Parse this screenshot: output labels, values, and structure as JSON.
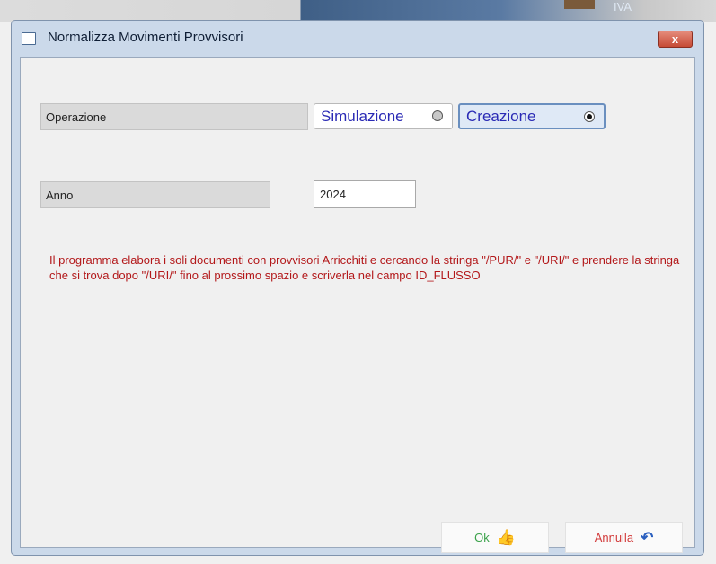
{
  "desktop": {
    "tag": "IVA"
  },
  "window": {
    "title": "Normalizza Movimenti Provvisori",
    "close_label": "x"
  },
  "form": {
    "operation_label": "Operazione",
    "options": [
      {
        "label": "Simulazione",
        "selected": false
      },
      {
        "label": "Creazione",
        "selected": true
      }
    ],
    "year_label": "Anno",
    "year_value": "2024"
  },
  "info": "Il programma elabora i soli documenti  con provvisori Arricchiti e cercando la stringa \"/PUR/\" e \"/URI/\" e prendere la stringa che si trova dopo \"/URI/\" fino al prossimo spazio e scriverla nel campo ID_FLUSSO",
  "buttons": {
    "ok_label": "Ok",
    "ok_icon": "thumbs-up-icon",
    "cancel_label": "Annulla",
    "cancel_icon": "undo-icon"
  }
}
